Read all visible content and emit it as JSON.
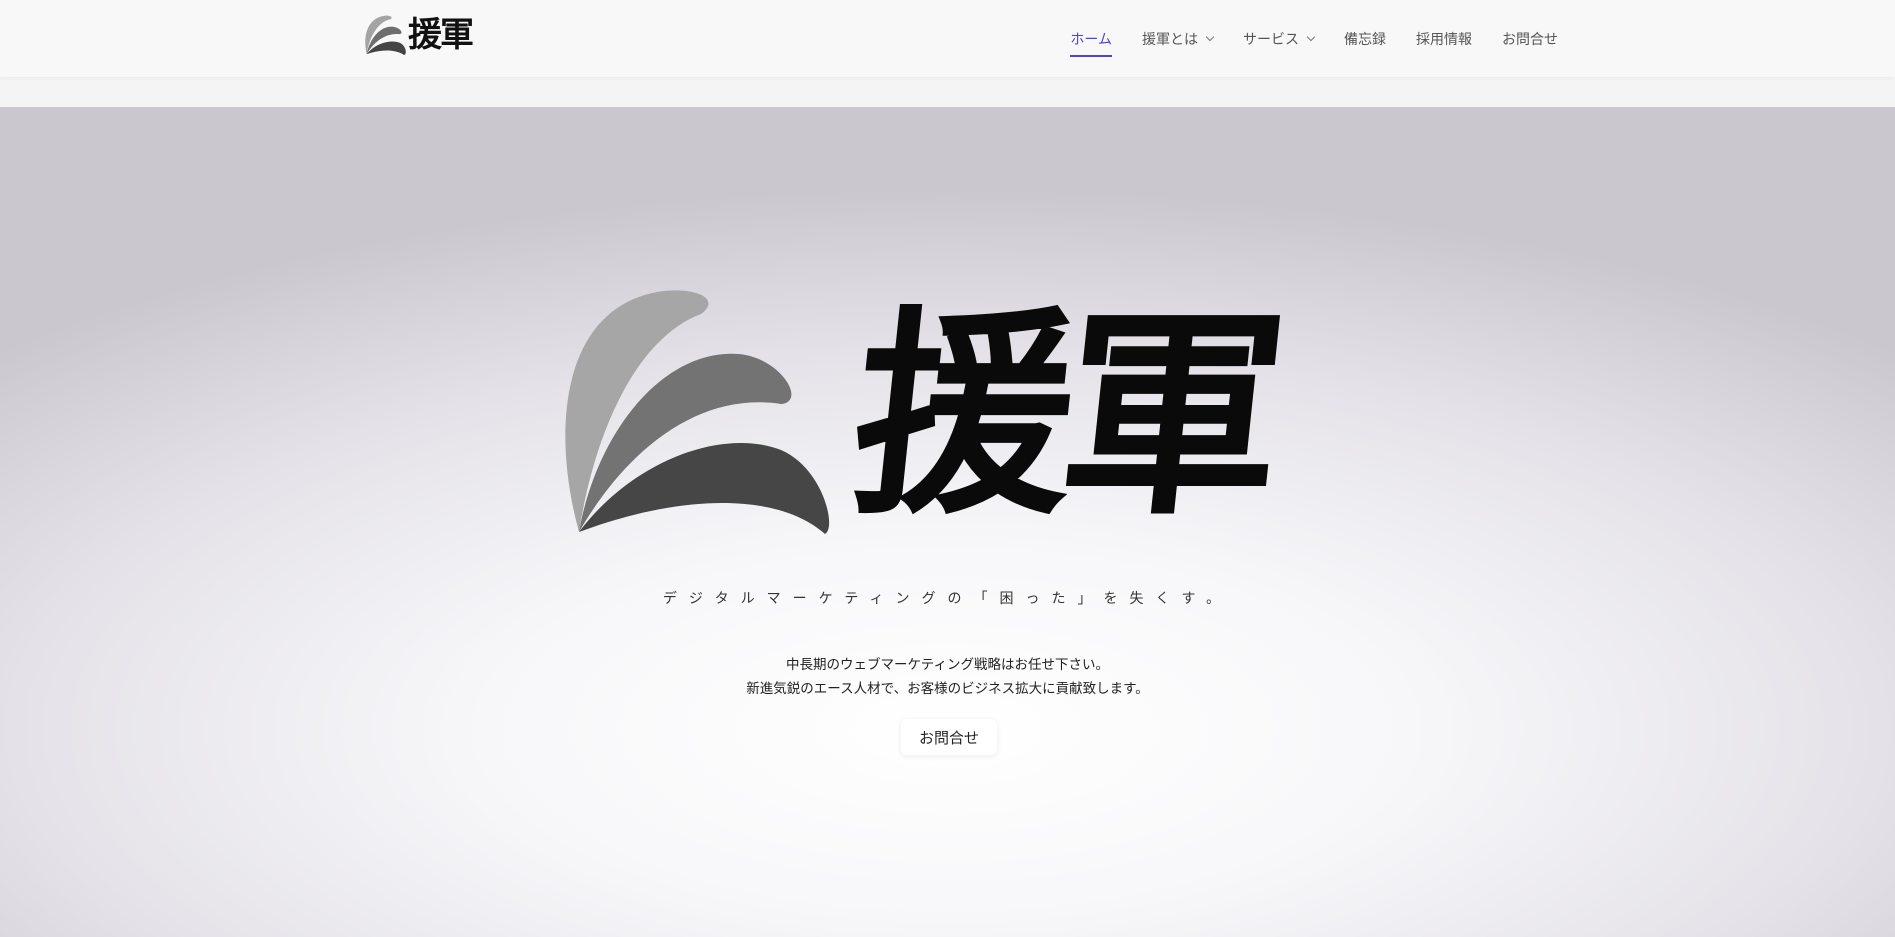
{
  "header": {
    "logo_text": "援軍",
    "nav": [
      {
        "label": "ホーム",
        "active": true,
        "has_dropdown": false
      },
      {
        "label": "援軍とは",
        "active": false,
        "has_dropdown": true
      },
      {
        "label": "サービス",
        "active": false,
        "has_dropdown": true
      },
      {
        "label": "備忘録",
        "active": false,
        "has_dropdown": false
      },
      {
        "label": "採用情報",
        "active": false,
        "has_dropdown": false
      },
      {
        "label": "お問合せ",
        "active": false,
        "has_dropdown": false
      }
    ]
  },
  "hero": {
    "logo_text": "援軍",
    "tagline": "デジタルマーケティングの「困った」を失くす。",
    "description": [
      "中長期のウェブマーケティング戦略はお任せ下さい。",
      "新進気鋭のエース人材で、お客様のビジネス拡大に貢献致します。"
    ],
    "cta_label": "お問合せ"
  },
  "colors": {
    "accent": "#4f44d8",
    "text": "#222222",
    "nav_text": "#555555"
  },
  "icons": {
    "logo": "leaf-fan-logo-icon",
    "dropdown": "chevron-down-icon"
  }
}
